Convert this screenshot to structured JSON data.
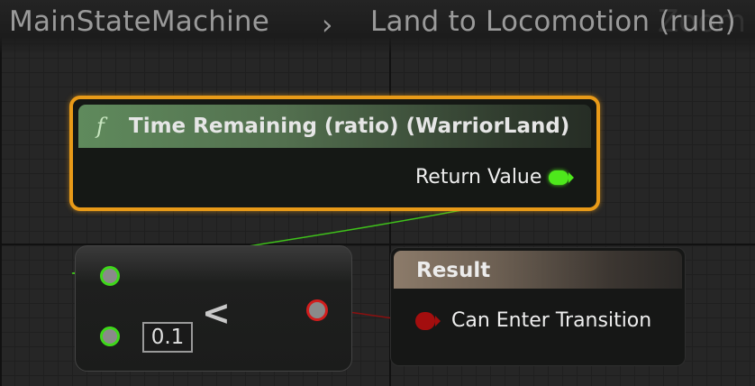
{
  "breadcrumb": {
    "root": "MainStateMachine",
    "separator": "›",
    "current": "Land to Locomotion (rule)",
    "watermark": "Zoom"
  },
  "function_node": {
    "icon": "function-icon",
    "icon_glyph": "f",
    "title": "Time Remaining (ratio) (WarriorLand)",
    "output_label": "Return Value",
    "header_color": "#5f8a5c",
    "border_color": "#e89a18"
  },
  "compare_node": {
    "operator": "<",
    "input_b_value": "0.1",
    "pin_color": "#3fd81a",
    "output_pin_color": "#d11d1d"
  },
  "result_node": {
    "title": "Result",
    "input_label": "Can Enter Transition",
    "header_color": "#8c7b6a",
    "pin_color": "#a30e0e"
  },
  "wires": {
    "float_wire_color": "#3fc21a",
    "bool_wire_color": "#8a1010"
  }
}
